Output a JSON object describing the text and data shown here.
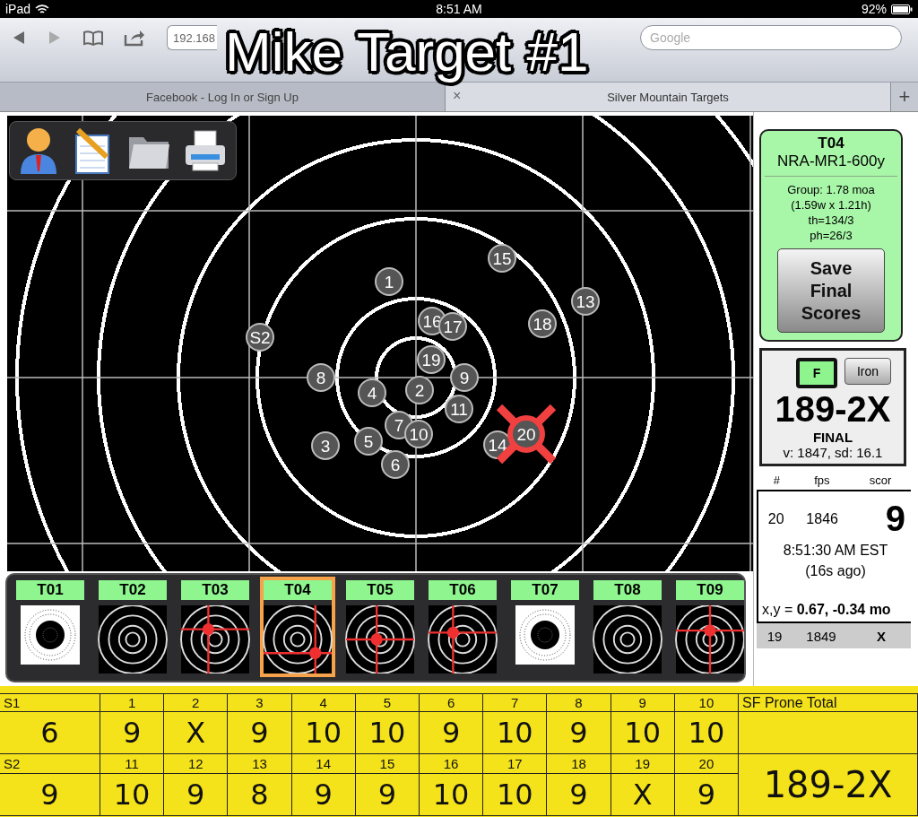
{
  "status_bar": {
    "device": "iPad",
    "time": "8:51 AM",
    "battery": "92%"
  },
  "browser": {
    "url": "192.168",
    "search_placeholder": "Google",
    "tabs": [
      {
        "title": "Facebook - Log In or Sign Up",
        "selected": false
      },
      {
        "title": "Silver Mountain Targets",
        "selected": true,
        "close": "×"
      }
    ],
    "new_tab": "+"
  },
  "overlay_title": "Mike Target #1",
  "target": {
    "shots": [
      {
        "label": "1",
        "kind": "shot"
      },
      {
        "label": "2",
        "kind": "shot"
      },
      {
        "label": "3",
        "kind": "shot"
      },
      {
        "label": "4",
        "kind": "shot"
      },
      {
        "label": "5",
        "kind": "shot"
      },
      {
        "label": "7",
        "kind": "shot"
      },
      {
        "label": "6",
        "kind": "shot"
      },
      {
        "label": "8",
        "kind": "shot"
      },
      {
        "label": "9",
        "kind": "shot"
      },
      {
        "label": "10",
        "kind": "shot"
      },
      {
        "label": "11",
        "kind": "shot"
      },
      {
        "label": "13",
        "kind": "shot"
      },
      {
        "label": "14",
        "kind": "shot"
      },
      {
        "label": "15",
        "kind": "shot"
      },
      {
        "label": "16",
        "kind": "shot"
      },
      {
        "label": "17",
        "kind": "shot"
      },
      {
        "label": "18",
        "kind": "shot"
      },
      {
        "label": "19",
        "kind": "shot"
      },
      {
        "label": "20",
        "kind": "latest"
      },
      {
        "label": "S2",
        "kind": "sighter"
      }
    ]
  },
  "thumbnails": [
    {
      "label": "T01",
      "kind": "paper",
      "selected": false
    },
    {
      "label": "T02",
      "kind": "plain",
      "selected": false
    },
    {
      "label": "T03",
      "kind": "marked",
      "selected": false
    },
    {
      "label": "T04",
      "kind": "marked",
      "selected": true
    },
    {
      "label": "T05",
      "kind": "marked",
      "selected": false
    },
    {
      "label": "T06",
      "kind": "marked",
      "selected": false
    },
    {
      "label": "T07",
      "kind": "paper",
      "selected": false
    },
    {
      "label": "T08",
      "kind": "plain",
      "selected": false
    },
    {
      "label": "T09",
      "kind": "marked",
      "selected": false
    }
  ],
  "panel": {
    "target_id": "T04",
    "target_type": "NRA-MR1-600y",
    "stats": [
      "Group: 1.78 moa",
      "(1.59w x 1.21h)",
      "th=134/3",
      "ph=26/3"
    ],
    "save_button": "Save Final Scores",
    "modes": [
      {
        "label": "F",
        "selected": true
      },
      {
        "label": "Iron",
        "selected": false
      }
    ],
    "score": "189-2X",
    "status": "FINAL",
    "velocity": "v: 1847, sd: 16.1",
    "shot_table": {
      "columns": [
        "#",
        "fps",
        "scor"
      ],
      "current": {
        "number": "20",
        "fps": "1846",
        "score": "9",
        "time": "8:51:30 AM EST",
        "ago": "(16s ago)",
        "coords": "x,y = **0.67, -0.34 mo**"
      },
      "previous": {
        "number": "19",
        "fps": "1849",
        "score": "X"
      }
    }
  },
  "scorecard": {
    "total_label": "SF Prone Total",
    "total": "189-2X",
    "strings": [
      {
        "label": "S1",
        "shot_numbers": [
          "1",
          "2",
          "3",
          "4",
          "5",
          "6",
          "7",
          "8",
          "9",
          "10"
        ],
        "sighter": "6",
        "scores": [
          "9",
          "X",
          "9",
          "10",
          "10",
          "9",
          "10",
          "9",
          "10",
          "10"
        ]
      },
      {
        "label": "S2",
        "shot_numbers": [
          "11",
          "12",
          "13",
          "14",
          "15",
          "16",
          "17",
          "18",
          "19",
          "20"
        ],
        "sighter": "9",
        "scores": [
          "10",
          "9",
          "8",
          "9",
          "9",
          "10",
          "10",
          "9",
          "X",
          "9"
        ]
      }
    ]
  }
}
